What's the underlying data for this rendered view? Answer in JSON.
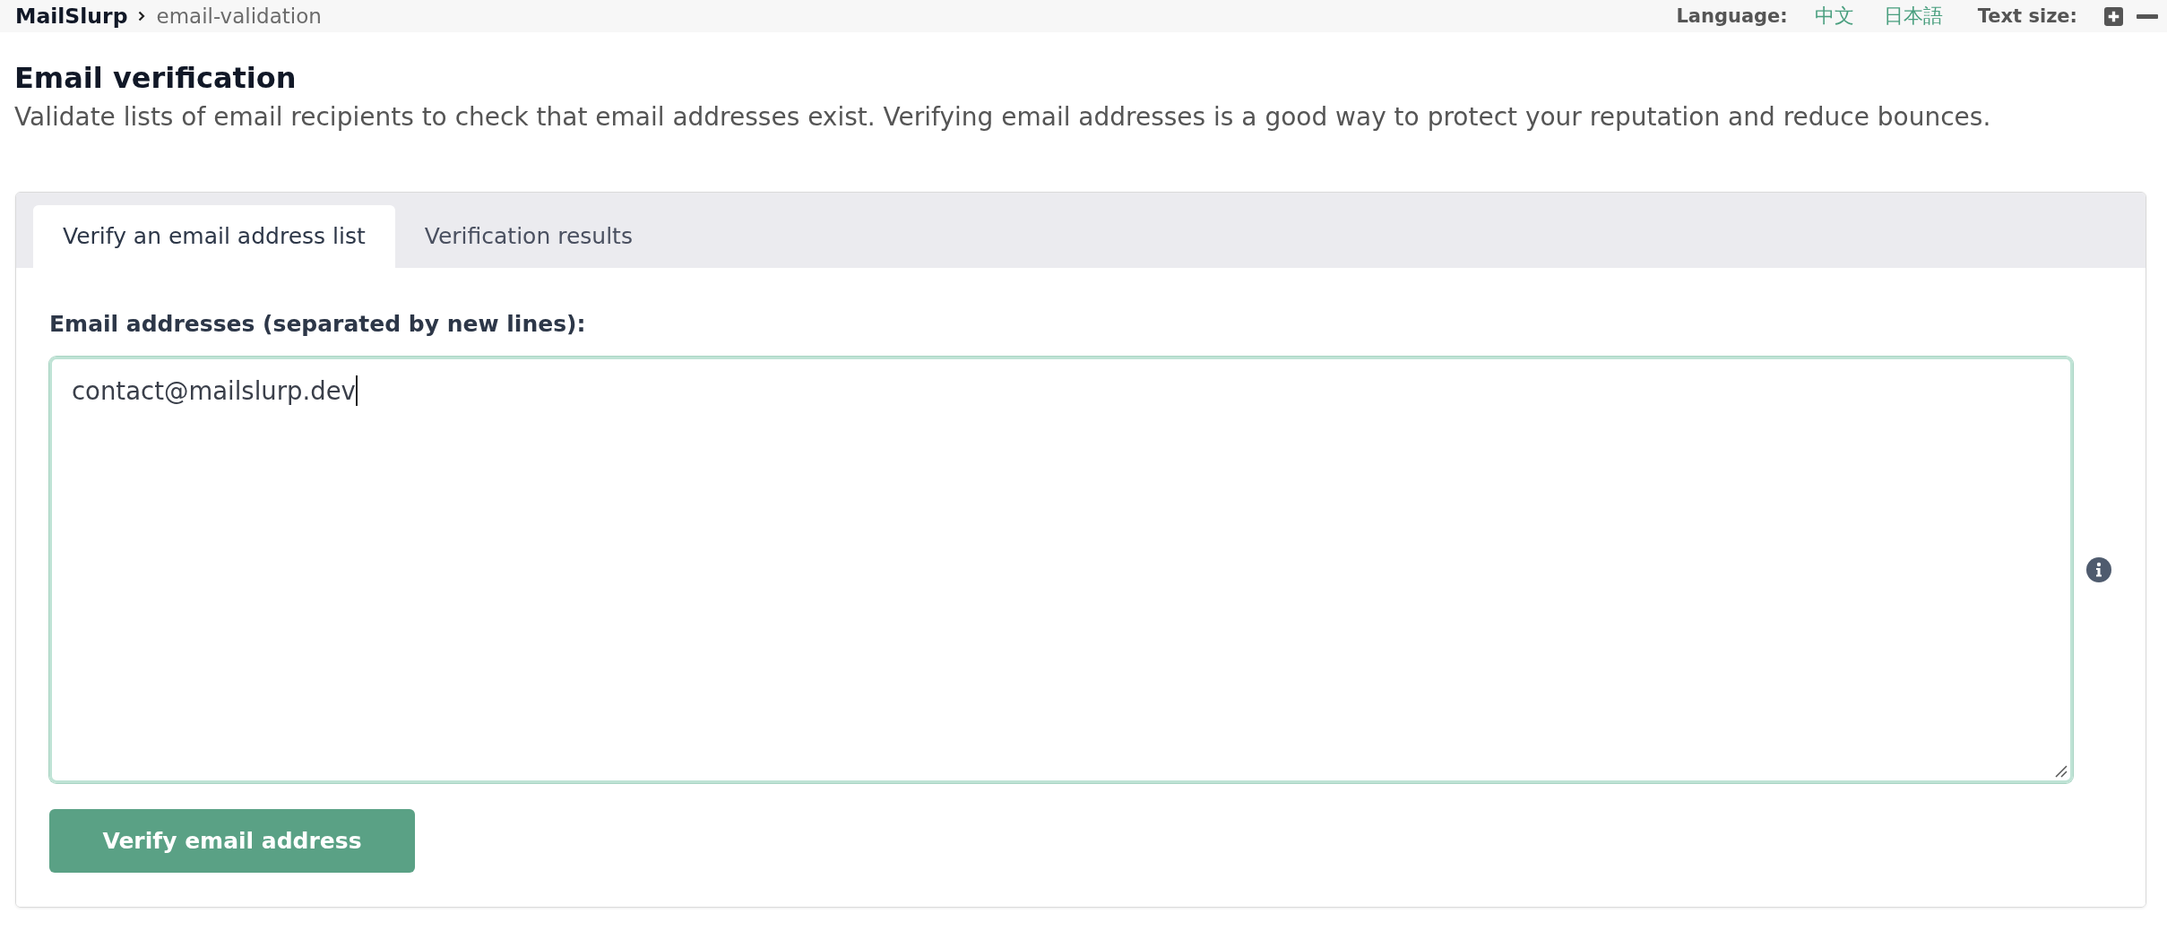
{
  "breadcrumb": [
    {
      "label": "MailSlurp"
    },
    {
      "label": "email-validation"
    }
  ],
  "toolbar": {
    "language_label": "Language:",
    "languages": [
      {
        "label": "中文"
      },
      {
        "label": "日本語"
      }
    ],
    "text_size_label": "Text size:"
  },
  "page": {
    "title": "Email verification",
    "description": "Validate lists of email recipients to check that email addresses exist. Verifying email addresses is a good way to protect your reputation and reduce bounces."
  },
  "tabs": [
    {
      "label": "Verify an email address list",
      "selected": true
    },
    {
      "label": "Verification results",
      "selected": false
    }
  ],
  "form": {
    "label": "Email addresses (separated by new lines):",
    "value": "contact@mailslurp.dev",
    "focused": true,
    "submit": "Verify email address"
  }
}
